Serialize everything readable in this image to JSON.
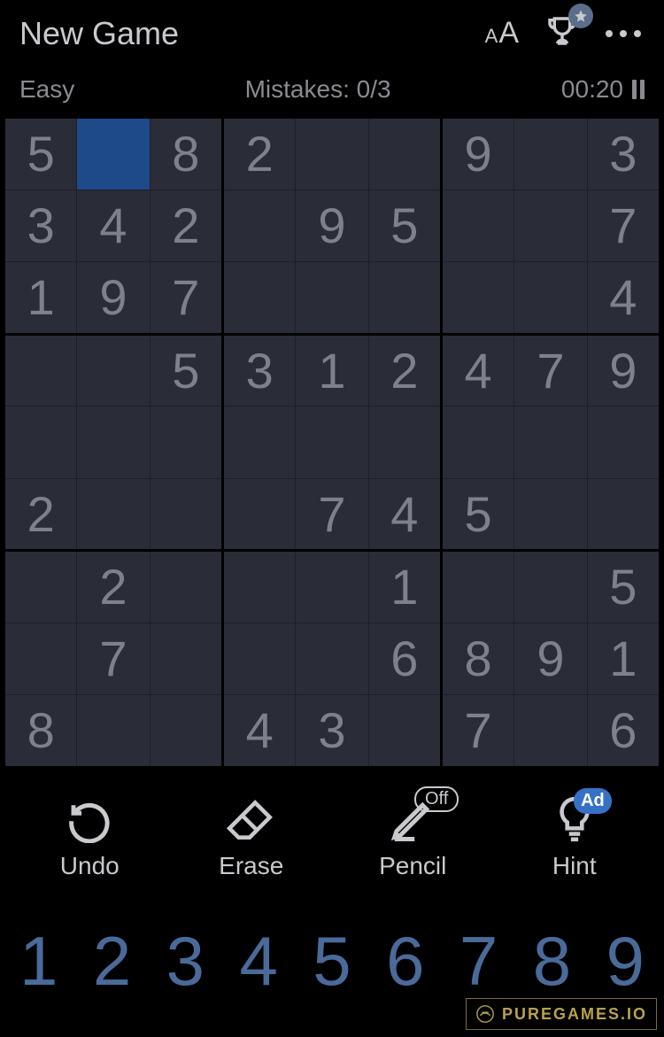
{
  "header": {
    "title": "New Game"
  },
  "status": {
    "difficulty": "Easy",
    "mistakes_label": "Mistakes: 0/3",
    "timer": "00:20"
  },
  "board": {
    "selected": {
      "row": 0,
      "col": 1
    },
    "rows": [
      [
        "5",
        "",
        "8",
        "2",
        "",
        "",
        "9",
        "",
        "3"
      ],
      [
        "3",
        "4",
        "2",
        "",
        "9",
        "5",
        "",
        "",
        "7"
      ],
      [
        "1",
        "9",
        "7",
        "",
        "",
        "",
        "",
        "",
        "4"
      ],
      [
        "",
        "",
        "5",
        "3",
        "1",
        "2",
        "4",
        "7",
        "9"
      ],
      [
        "",
        "",
        "",
        "",
        "",
        "",
        "",
        "",
        ""
      ],
      [
        "2",
        "",
        "",
        "",
        "7",
        "4",
        "5",
        "",
        ""
      ],
      [
        "",
        "2",
        "",
        "",
        "",
        "1",
        "",
        "",
        "5"
      ],
      [
        "",
        "7",
        "",
        "",
        "",
        "6",
        "8",
        "9",
        "1"
      ],
      [
        "8",
        "",
        "",
        "4",
        "3",
        "",
        "7",
        "",
        "6"
      ]
    ]
  },
  "tools": {
    "undo": "Undo",
    "erase": "Erase",
    "pencil": "Pencil",
    "pencil_state": "Off",
    "hint": "Hint",
    "hint_badge": "Ad"
  },
  "numpad": [
    "1",
    "2",
    "3",
    "4",
    "5",
    "6",
    "7",
    "8",
    "9"
  ],
  "watermark": "PUREGAMES.IO"
}
